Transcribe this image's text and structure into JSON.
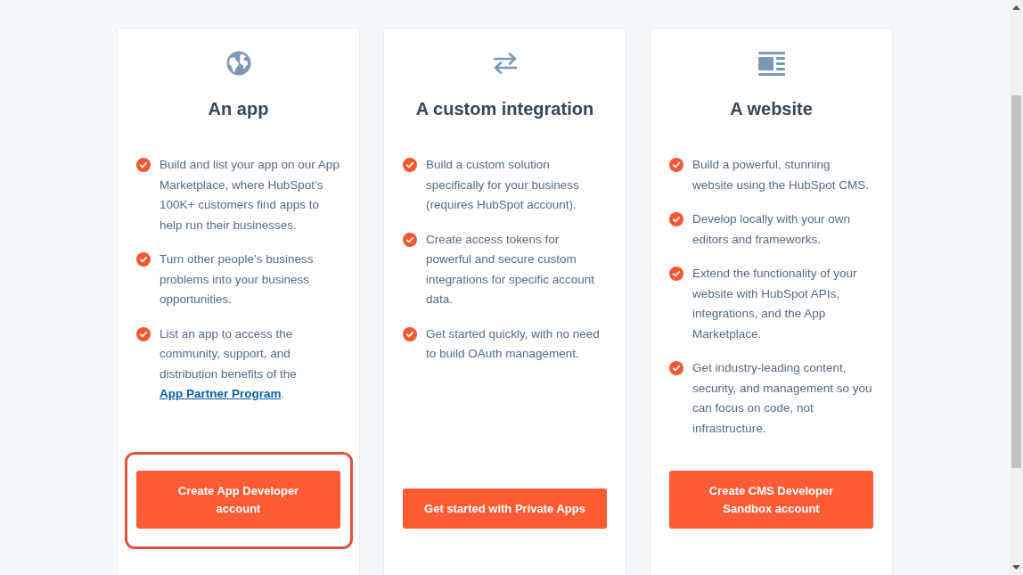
{
  "cards": [
    {
      "kind": "app",
      "title": "An app",
      "points": [
        {
          "text": "Build and list your app on our App Marketplace, where HubSpot’s 100K+ customers find apps to help run their businesses."
        },
        {
          "text": "Turn other people’s business problems into your business opportunities."
        },
        {
          "text": "List an app to access the community, support, and distribution benefits of the",
          "link": "App Partner Program",
          "tail": "."
        }
      ],
      "button": {
        "label": "Create App Developer account",
        "highlighted": true
      }
    },
    {
      "kind": "integration",
      "title": "A custom integration",
      "points": [
        {
          "text": "Build a custom solution specifically for your business (requires HubSpot account)."
        },
        {
          "text": "Create access tokens for powerful and secure custom integrations for specific account data."
        },
        {
          "text": "Get started quickly, with no need to build OAuth management."
        }
      ],
      "button": {
        "label": "Get started with Private Apps",
        "highlighted": false
      }
    },
    {
      "kind": "website",
      "title": "A website",
      "points": [
        {
          "text": "Build a powerful, stunning website using the HubSpot CMS."
        },
        {
          "text": "Develop locally with your own editors and frameworks."
        },
        {
          "text": "Extend the functionality of your website with HubSpot APIs, integrations, and the App Marketplace."
        },
        {
          "text": "Get industry-leading content, security, and management so you can focus on code, not infrastructure."
        }
      ],
      "button": {
        "label": "Create CMS Developer Sandbox account",
        "highlighted": false
      }
    }
  ]
}
